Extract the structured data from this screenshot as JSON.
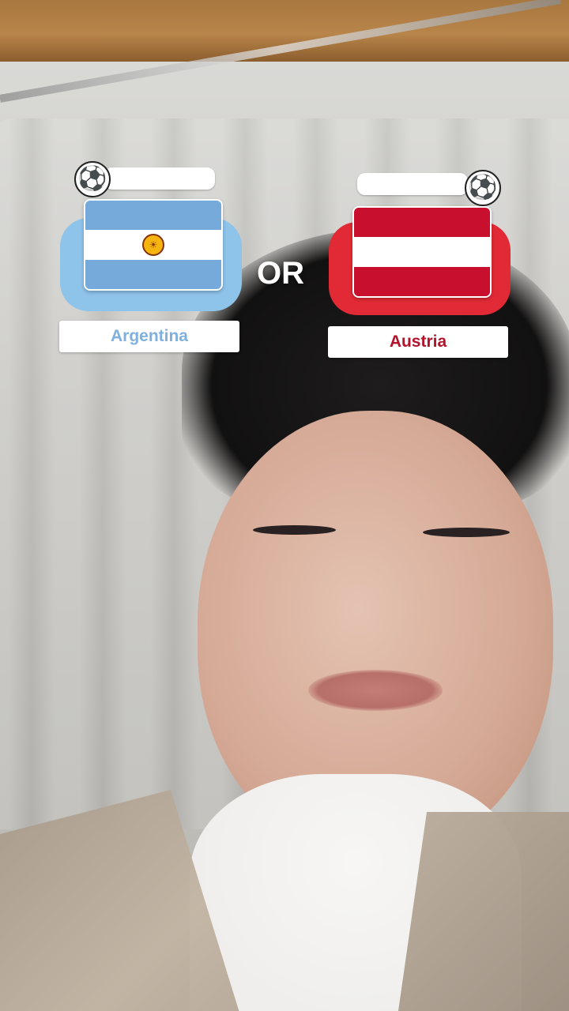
{
  "overlay": {
    "left_team": {
      "name": "Argentina",
      "flag_colors": [
        "#75aadb",
        "#ffffff",
        "#75aadb"
      ],
      "accent": "#8ec3ea",
      "icon": "soccer-ball-icon"
    },
    "separator": "OR",
    "right_team": {
      "name": "Austria",
      "flag_colors": [
        "#c8102e",
        "#ffffff",
        "#c8102e"
      ],
      "accent": "#e12a36",
      "icon": "soccer-ball-icon"
    }
  }
}
